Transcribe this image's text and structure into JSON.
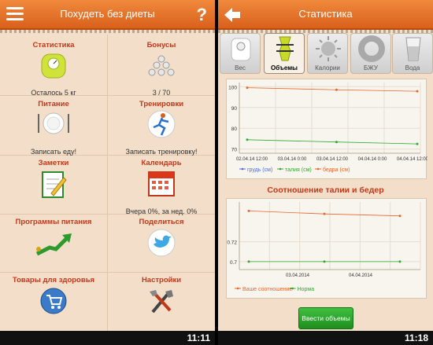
{
  "left": {
    "title": "Похудеть без диеты",
    "help": "?",
    "items": [
      {
        "title": "Статистика",
        "sub": "Осталось 5 кг"
      },
      {
        "title": "Бонусы",
        "sub": "3 / 70"
      },
      {
        "title": "Питание",
        "sub": "Записать еду!"
      },
      {
        "title": "Тренировки",
        "sub": "Записать тренировку!"
      },
      {
        "title": "Заметки",
        "sub": ""
      },
      {
        "title": "Календарь",
        "sub": "Вчера 0%, за нед. 0%"
      },
      {
        "title": "Программы питания",
        "sub": ""
      },
      {
        "title": "Поделиться",
        "sub": ""
      },
      {
        "title": "Товары для здоровья",
        "sub": ""
      },
      {
        "title": "Настройки",
        "sub": ""
      }
    ],
    "clock": "11:11"
  },
  "right": {
    "title": "Статистика",
    "tabs": [
      {
        "label": "Вес",
        "icon": "scale-icon"
      },
      {
        "label": "Объемы",
        "icon": "body-measure-icon"
      },
      {
        "label": "Калории",
        "icon": "sun-icon"
      },
      {
        "label": "БЖУ",
        "icon": "ring-icon"
      },
      {
        "label": "Вода",
        "icon": "glass-icon"
      }
    ],
    "section_title": "Соотношение талии и бедер",
    "button": "Ввести объемы",
    "clock": "11:18"
  },
  "chart_data": [
    {
      "type": "line",
      "x": [
        "02.04.14 12:00",
        "03.04.14 0:00",
        "03.04.14 12:00",
        "04.04.14 0:00",
        "04.04.14 12:00"
      ],
      "yticks": [
        70,
        80,
        90,
        100
      ],
      "ylim": [
        68,
        102
      ],
      "series": [
        {
          "name": "грудь (см)",
          "color": "#4a6fd8",
          "points": [],
          "marker": "-"
        },
        {
          "name": "талия (см)",
          "color": "#2faa2f",
          "points": [
            [
              0,
              74.5
            ],
            [
              2.1,
              73.4
            ],
            [
              4,
              72.5
            ]
          ]
        },
        {
          "name": "бедра (см)",
          "color": "#e8662a",
          "points": [
            [
              0,
              99.5
            ],
            [
              2.1,
              98.5
            ],
            [
              4,
              97.8
            ]
          ]
        }
      ]
    },
    {
      "type": "line",
      "x": [
        "03.04.2014",
        "04.04.2014"
      ],
      "yticks": [
        0.7,
        0.72
      ],
      "ylim": [
        0.692,
        0.76
      ],
      "series": [
        {
          "name": "Ваше соотношение",
          "color": "#e8662a",
          "points": [
            [
              0,
              0.751
            ],
            [
              1,
              0.748
            ],
            [
              2,
              0.746
            ]
          ]
        },
        {
          "name": "Норма",
          "color": "#2faa2f",
          "points": [
            [
              0,
              0.7
            ],
            [
              1,
              0.7
            ],
            [
              2,
              0.7
            ]
          ]
        }
      ]
    }
  ]
}
